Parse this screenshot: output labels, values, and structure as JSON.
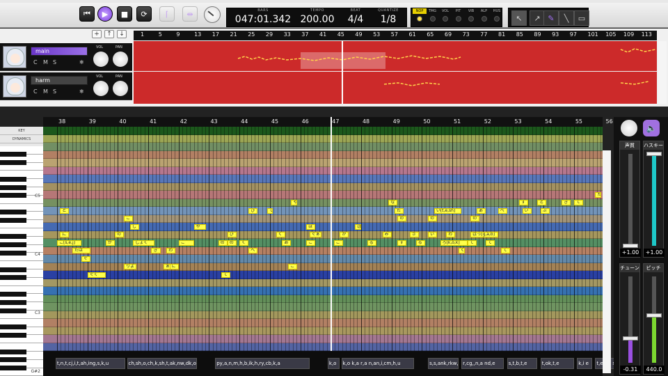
{
  "transport": {
    "rewind_icon": "skip-back-icon",
    "play_icon": "play-icon",
    "stop_icon": "stop-icon",
    "loop_icon": "loop-icon"
  },
  "display": {
    "bars_label": "BARS",
    "bars_value": "047:01.342",
    "tempo_label": "TEMPO",
    "tempo_value": "200.00",
    "beat_label": "BEAT",
    "beat_value": "4/4",
    "quantize_label": "QUANTIZE",
    "quantize_value": "1/8"
  },
  "params": [
    {
      "label": "NOP",
      "on": true
    },
    {
      "label": "TMG",
      "on": false
    },
    {
      "label": "VOL",
      "on": false
    },
    {
      "label": "PIT",
      "on": false
    },
    {
      "label": "VIB",
      "on": false
    },
    {
      "label": "ALP",
      "on": false
    },
    {
      "label": "HUS",
      "on": false
    }
  ],
  "tracks": [
    {
      "name": "main",
      "active": true,
      "buttons": [
        "C",
        "M",
        "S"
      ],
      "vol_label": "VOL",
      "pan_label": "PAN"
    },
    {
      "name": "harm",
      "active": false,
      "buttons": [
        "C",
        "M",
        "S"
      ],
      "vol_label": "VOL",
      "pan_label": "PAN"
    }
  ],
  "timeline": {
    "bars": [
      "1",
      "5",
      "9",
      "13",
      "17",
      "21",
      "25",
      "29",
      "33",
      "37",
      "41",
      "45",
      "49",
      "53",
      "57",
      "61",
      "65",
      "69",
      "73",
      "77",
      "81",
      "85",
      "89",
      "93",
      "97",
      "101",
      "105",
      "109",
      "113"
    ],
    "lane_color": "#cc2a2a"
  },
  "roll": {
    "key_label": "KEY",
    "dynamics_label": "DYNAMICS",
    "octave_labels": [
      "C5",
      "C4",
      "C3"
    ],
    "bottom_label": "G#2",
    "bars": [
      "38",
      "39",
      "40",
      "41",
      "42",
      "43",
      "44",
      "45",
      "46",
      "47",
      "48",
      "49",
      "50",
      "51",
      "52",
      "53",
      "54",
      "55",
      "56"
    ],
    "notes": [
      {
        "row": 10,
        "bar": 38.1,
        "len": 0.3,
        "text": "と"
      },
      {
        "row": 9,
        "bar": 45.7,
        "len": 0.2,
        "text": "や"
      },
      {
        "row": 9,
        "bar": 48.9,
        "len": 0.3,
        "text": "な"
      },
      {
        "row": 9,
        "bar": 53.2,
        "len": 0.3,
        "text": "す"
      },
      {
        "row": 9,
        "bar": 53.8,
        "len": 0.3,
        "text": "と"
      },
      {
        "row": 9,
        "bar": 54.6,
        "len": 0.3,
        "text": "き"
      },
      {
        "row": 9,
        "bar": 55.0,
        "len": 0.3,
        "text": "て"
      },
      {
        "row": 8,
        "bar": 55.7,
        "len": 0.2,
        "text": "た"
      },
      {
        "row": 8,
        "bar": 56.1,
        "len": 0.2,
        "text": "い"
      },
      {
        "row": 10,
        "bar": 44.3,
        "len": 0.3,
        "text": "ひ"
      },
      {
        "row": 10,
        "bar": 44.9,
        "len": 0.2,
        "text": "て"
      },
      {
        "row": 10,
        "bar": 49.1,
        "len": 0.3,
        "text": "た"
      },
      {
        "row": 10,
        "bar": 50.4,
        "len": 0.9,
        "text": "い[t,e,sh]"
      },
      {
        "row": 10,
        "bar": 51.8,
        "len": 0.3,
        "text": "あ"
      },
      {
        "row": 10,
        "bar": 52.5,
        "len": 0.3,
        "text": "べ"
      },
      {
        "row": 10,
        "bar": 53.3,
        "len": 0.3,
        "text": "い"
      },
      {
        "row": 10,
        "bar": 53.9,
        "len": 0.3,
        "text": "ぶ"
      },
      {
        "row": 11,
        "bar": 40.2,
        "len": 0.3,
        "text": "こ"
      },
      {
        "row": 11,
        "bar": 49.2,
        "len": 0.3,
        "text": "の"
      },
      {
        "row": 11,
        "bar": 50.2,
        "len": 0.3,
        "text": "の"
      },
      {
        "row": 11,
        "bar": 51.6,
        "len": 0.3,
        "text": "の"
      },
      {
        "row": 12,
        "bar": 40.4,
        "len": 0.3,
        "text": "し"
      },
      {
        "row": 12,
        "bar": 42.5,
        "len": 0.4,
        "text": "や"
      },
      {
        "row": 12,
        "bar": 46.2,
        "len": 0.3,
        "text": "ぽ"
      },
      {
        "row": 12,
        "bar": 47.8,
        "len": 0.2,
        "text": "ぱ"
      },
      {
        "row": 13,
        "bar": 38.1,
        "len": 0.3,
        "text": "に"
      },
      {
        "row": 13,
        "bar": 39.9,
        "len": 0.3,
        "text": "の"
      },
      {
        "row": 13,
        "bar": 43.6,
        "len": 0.3,
        "text": "ひ"
      },
      {
        "row": 13,
        "bar": 45.2,
        "len": 0.3,
        "text": "く"
      },
      {
        "row": 13,
        "bar": 46.3,
        "len": 0.4,
        "text": "ぐぁ"
      },
      {
        "row": 13,
        "bar": 47.3,
        "len": 0.3,
        "text": "か"
      },
      {
        "row": 13,
        "bar": 48.7,
        "len": 0.3,
        "text": "み"
      },
      {
        "row": 13,
        "bar": 49.6,
        "len": 0.3,
        "text": "さ"
      },
      {
        "row": 13,
        "bar": 50.2,
        "len": 0.3,
        "text": "い"
      },
      {
        "row": 13,
        "bar": 50.8,
        "len": 0.3,
        "text": "わ"
      },
      {
        "row": 13,
        "bar": 51.6,
        "len": 0.9,
        "text": "ぱっ[g,a,b]"
      },
      {
        "row": 14,
        "bar": 38.0,
        "len": 0.8,
        "text": "こ[s,e,j]"
      },
      {
        "row": 14,
        "bar": 39.6,
        "len": 0.3,
        "text": "が"
      },
      {
        "row": 14,
        "bar": 40.5,
        "len": 0.7,
        "text": "しょく"
      },
      {
        "row": 14,
        "bar": 42.0,
        "len": 0.5,
        "text": "こ"
      },
      {
        "row": 14,
        "bar": 43.3,
        "len": 0.3,
        "text": "の"
      },
      {
        "row": 14,
        "bar": 43.6,
        "len": 0.3,
        "text": "の"
      },
      {
        "row": 14,
        "bar": 44.0,
        "len": 0.3,
        "text": "く"
      },
      {
        "row": 14,
        "bar": 45.4,
        "len": 0.3,
        "text": "あ"
      },
      {
        "row": 14,
        "bar": 46.2,
        "len": 0.3,
        "text": "こ"
      },
      {
        "row": 14,
        "bar": 47.1,
        "len": 0.3,
        "text": "こ"
      },
      {
        "row": 14,
        "bar": 48.2,
        "len": 0.3,
        "text": "る"
      },
      {
        "row": 14,
        "bar": 49.2,
        "len": 0.3,
        "text": "す"
      },
      {
        "row": 14,
        "bar": 49.8,
        "len": 0.3,
        "text": "る"
      },
      {
        "row": 14,
        "bar": 50.6,
        "len": 0.9,
        "text": "ろ[k,o,k]"
      },
      {
        "row": 14,
        "bar": 51.5,
        "len": 0.3,
        "text": "て"
      },
      {
        "row": 14,
        "bar": 52.1,
        "len": 0.3,
        "text": "て"
      },
      {
        "row": 15,
        "bar": 38.5,
        "len": 0.6,
        "text": "たは"
      },
      {
        "row": 15,
        "bar": 41.1,
        "len": 0.3,
        "text": "き"
      },
      {
        "row": 15,
        "bar": 41.6,
        "len": 0.3,
        "text": "わ"
      },
      {
        "row": 15,
        "bar": 44.3,
        "len": 0.3,
        "text": "へ"
      },
      {
        "row": 15,
        "bar": 51.2,
        "len": 0.2,
        "text": "く"
      },
      {
        "row": 15,
        "bar": 52.6,
        "len": 0.3,
        "text": "て"
      },
      {
        "row": 16,
        "bar": 38.8,
        "len": 0.3,
        "text": "ぐ"
      },
      {
        "row": 17,
        "bar": 40.2,
        "len": 0.4,
        "text": "りよ"
      },
      {
        "row": 17,
        "bar": 41.5,
        "len": 0.3,
        "text": "ぁ"
      },
      {
        "row": 17,
        "bar": 41.7,
        "len": 0.3,
        "text": "に"
      },
      {
        "row": 17,
        "bar": 45.6,
        "len": 0.3,
        "text": "こ"
      },
      {
        "row": 18,
        "bar": 39.0,
        "len": 0.6,
        "text": "ぐく"
      },
      {
        "row": 18,
        "bar": 43.4,
        "len": 0.3,
        "text": "て"
      }
    ],
    "phonemes": [
      {
        "bar": 37.95,
        "len": 2.3,
        "text": "t,n,t,cj,i,t,ah,ing,s,k,u"
      },
      {
        "bar": 40.3,
        "len": 2.3,
        "text": "ch,sh,o,ch,k,sh,t,ak,nw,dk,o"
      },
      {
        "bar": 43.2,
        "len": 3.1,
        "text": "py,a,n,m,h,b,ik,h,ry,cb,k,a"
      },
      {
        "bar": 46.9,
        "len": 0.4,
        "text": "k,o"
      },
      {
        "bar": 47.35,
        "len": 2.4,
        "text": "k,o k,a r,a n,an,i,cm,h,u"
      },
      {
        "bar": 50.2,
        "len": 1.0,
        "text": "s,s,ank,rkw,a"
      },
      {
        "bar": 51.3,
        "len": 1.4,
        "text": "r,cg,,n,a nd,e"
      },
      {
        "bar": 52.8,
        "len": 1.0,
        "text": "s,t,b,t,e"
      },
      {
        "bar": 53.9,
        "len": 1.1,
        "text": "t,ok,t,e"
      },
      {
        "bar": 55.1,
        "len": 0.5,
        "text": "k,i e"
      },
      {
        "bar": 55.7,
        "len": 1.0,
        "text": "t,e t,a s,k,a"
      }
    ],
    "playhead_bar": 47.0
  },
  "faders": [
    {
      "label": "声質",
      "value": "+1.00",
      "fill": 0.0,
      "color": "#9a9a9a"
    },
    {
      "label": "ハスキー",
      "value": "+1.00",
      "fill": 1.0,
      "color": "#1ec8c8"
    },
    {
      "label": "チューン",
      "value": "-0.31",
      "fill": 0.28,
      "color": "#9a50e0"
    },
    {
      "label": "ピッチ",
      "value": "440.0",
      "fill": 0.55,
      "color": "#7cd830"
    }
  ]
}
